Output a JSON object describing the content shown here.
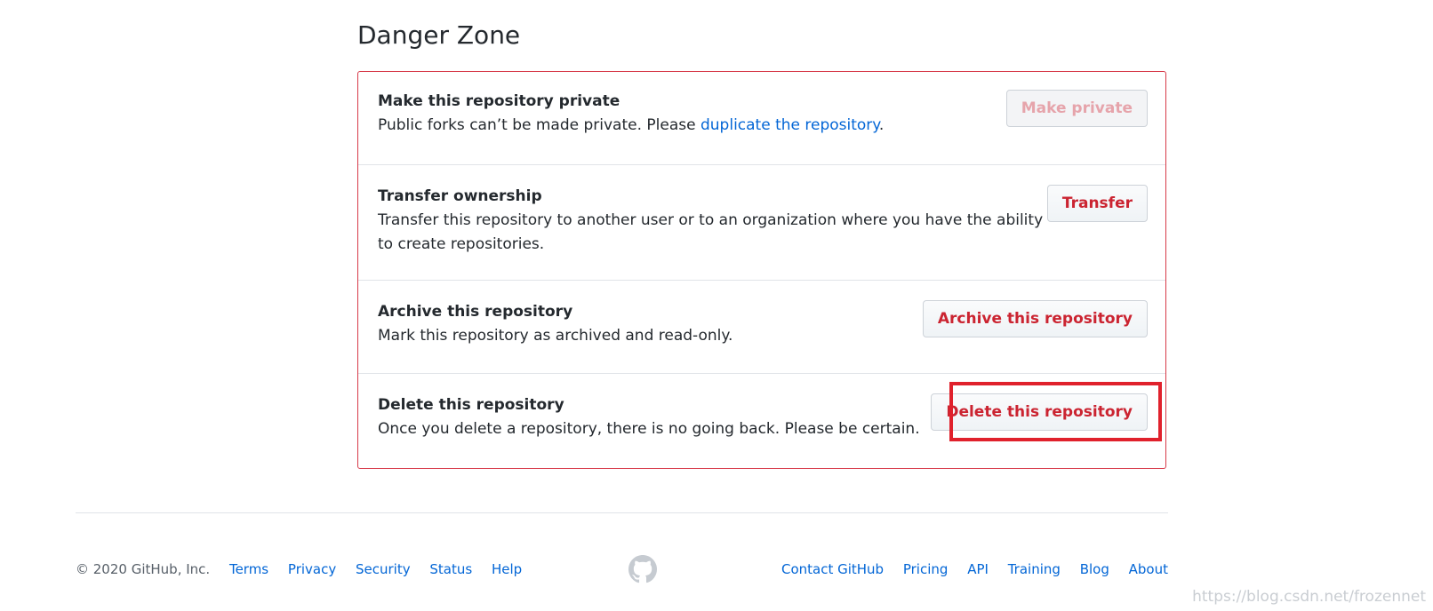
{
  "section": {
    "title": "Danger Zone"
  },
  "rows": [
    {
      "title": "Make this repository private",
      "desc_prefix": "Public forks can’t be made private. Please ",
      "desc_link": "duplicate the repository",
      "desc_suffix": ".",
      "button": "Make private"
    },
    {
      "title": "Transfer ownership",
      "desc": "Transfer this repository to another user or to an organization where you have the ability to create repositories.",
      "button": "Transfer"
    },
    {
      "title": "Archive this repository",
      "desc": "Mark this repository as archived and read-only.",
      "button": "Archive this repository"
    },
    {
      "title": "Delete this repository",
      "desc": "Once you delete a repository, there is no going back. Please be certain.",
      "button": "Delete this repository"
    }
  ],
  "footer": {
    "copyright": "© 2020 GitHub, Inc.",
    "left_links": [
      "Terms",
      "Privacy",
      "Security",
      "Status",
      "Help"
    ],
    "right_links": [
      "Contact GitHub",
      "Pricing",
      "API",
      "Training",
      "Blog",
      "About"
    ]
  },
  "watermark": "https://blog.csdn.net/frozennet",
  "colors": {
    "danger": "#cb2431",
    "danger_border": "#d73a49",
    "link": "#0366d6",
    "highlight": "#e0212c"
  },
  "icons": {
    "footer_logo": "github-octocat-icon"
  }
}
